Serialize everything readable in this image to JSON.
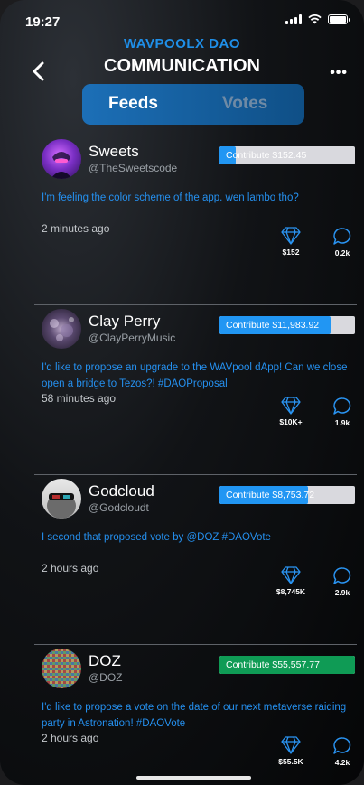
{
  "status_bar": {
    "time": "19:27"
  },
  "header": {
    "brand": "WAVPOOLX DAO",
    "title": "COMMUNICATION",
    "more_label": "•••"
  },
  "tabs": [
    {
      "label": "Feeds",
      "active": true
    },
    {
      "label": "Votes",
      "active": false
    }
  ],
  "colors": {
    "accent": "#1f8fe8",
    "contribute_blue": "#2196f3",
    "contribute_green": "#0f9b55",
    "track": "#d9d9de"
  },
  "posts": [
    {
      "name": "Sweets",
      "handle": "@TheSweetscode",
      "contribute_label": "Contribute $152.45",
      "contribute_fill": 0.12,
      "contribute_color": "#2196f3",
      "message": "I'm feeling the color scheme of the app. wen lambo tho?",
      "time_ago": "2 minutes ago",
      "tips": "$152",
      "comments": "0.2k"
    },
    {
      "name": "Clay Perry",
      "handle": "@ClayPerryMusic",
      "contribute_label": "Contribute $11,983.92",
      "contribute_fill": 0.82,
      "contribute_color": "#2196f3",
      "message": "I'd like to propose an upgrade to the WAVpool dApp! Can we close open a bridge to Tezos?! #DAOProposal",
      "time_ago": "58 minutes ago",
      "tips": "$10K+",
      "comments": "1.9k"
    },
    {
      "name": "Godcloud",
      "handle": "@Godcloudt",
      "contribute_label": "Contribute $8,753.72",
      "contribute_fill": 0.65,
      "contribute_color": "#2196f3",
      "message": "I second that proposed vote by @DOZ #DAOVote",
      "time_ago": "2 hours ago",
      "tips": "$8,745K",
      "comments": "2.9k"
    },
    {
      "name": "DOZ",
      "handle": "@DOZ",
      "contribute_label": "Contribute $55,557.77",
      "contribute_fill": 1.0,
      "contribute_color": "#0f9b55",
      "message": "I'd like to propose a vote on the date of our next metaverse raiding party in Astronation! #DAOVote",
      "time_ago": "2 hours ago",
      "tips": "$55.5K",
      "comments": "4.2k"
    }
  ]
}
